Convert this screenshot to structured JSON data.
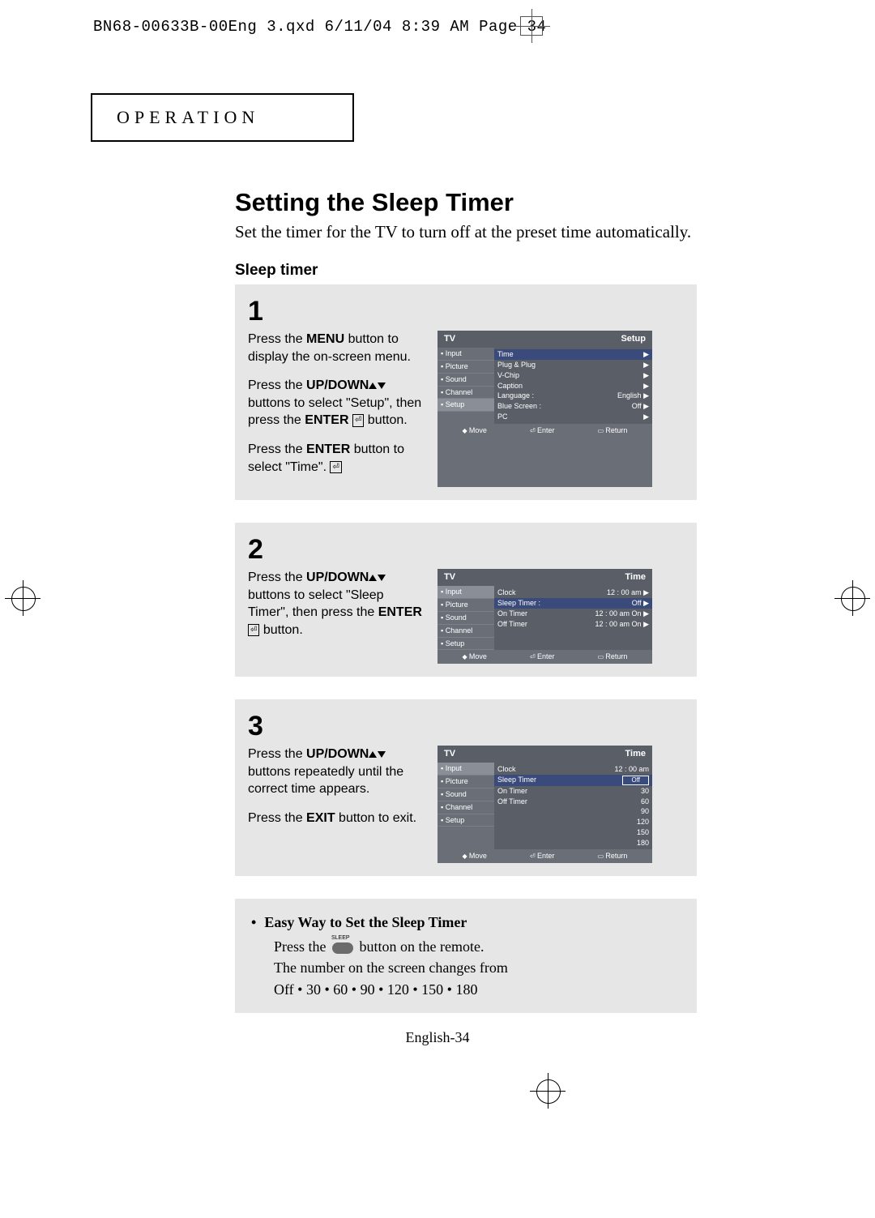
{
  "header": "BN68-00633B-00Eng 3.qxd  6/11/04 8:39 AM  Page 34",
  "section": "OPERATION",
  "title": "Setting the Sleep Timer",
  "intro": "Set the timer for the TV to turn off at the preset time automatically.",
  "subhead": "Sleep timer",
  "steps": [
    {
      "num": "1",
      "paras": [
        {
          "plain1": "Press the ",
          "b1": "MENU",
          "plain2": " button to display the on-screen menu."
        },
        {
          "plain1": "Press the ",
          "b1": "UP/DOWN",
          "icons": "ud",
          "plain2": " buttons to select \"Setup\", then press the ",
          "b2": "ENTER",
          "icon2": "enter",
          "plain3": " button."
        },
        {
          "plain1": "Press the ",
          "b1": "ENTER",
          "icon2": "enter",
          "plain2": " button to select \"Time\"."
        }
      ],
      "osd": {
        "title_left": "TV",
        "title_right": "Setup",
        "side": [
          "Input",
          "Picture",
          "Sound",
          "Channel",
          "Setup"
        ],
        "side_sel": 4,
        "rows": [
          {
            "l": "Time",
            "r": "▶",
            "hl": true
          },
          {
            "l": "Plug & Plug",
            "r": "▶"
          },
          {
            "l": "V-Chip",
            "r": "▶"
          },
          {
            "l": "Caption",
            "r": "▶"
          },
          {
            "l": "Language",
            "c": ":",
            "r": "English   ▶"
          },
          {
            "l": "Blue Screen",
            "c": ":",
            "r": "Off   ▶"
          },
          {
            "l": "PC",
            "r": "▶"
          }
        ],
        "foot": [
          "Move",
          "Enter",
          "Return"
        ]
      }
    },
    {
      "num": "2",
      "paras": [
        {
          "plain1": "Press the ",
          "b1": "UP/DOWN",
          "icons": "ud",
          "plain2": " buttons to select \"Sleep Timer\", then press the ",
          "b2": "ENTER",
          "icon2": "enter",
          "plain3": " button."
        }
      ],
      "osd": {
        "title_left": "TV",
        "title_right": "Time",
        "side": [
          "Input",
          "Picture",
          "Sound",
          "Channel",
          "Setup"
        ],
        "side_sel": 0,
        "rows": [
          {
            "l": "Clock",
            "r": "12 : 00  am   ▶"
          },
          {
            "l": "Sleep Timer",
            "c": ":",
            "r": "Off   ▶",
            "hl": true
          },
          {
            "l": "On Timer",
            "r": "12 : 00  am On ▶"
          },
          {
            "l": "Off Timer",
            "r": "12 : 00  am On ▶"
          }
        ],
        "foot": [
          "Move",
          "Enter",
          "Return"
        ]
      }
    },
    {
      "num": "3",
      "paras": [
        {
          "plain1": "Press the ",
          "b1": "UP/DOWN",
          "icons": "ud",
          "plain2": " buttons repeatedly until the correct time appears."
        },
        {
          "plain1": "Press the ",
          "b1": "EXIT",
          "plain2": " button to exit."
        }
      ],
      "osd": {
        "title_left": "TV",
        "title_right": "Time",
        "side": [
          "Input",
          "Picture",
          "Sound",
          "Channel",
          "Setup"
        ],
        "side_sel": 0,
        "rows": [
          {
            "l": "Clock",
            "r": "12 : 00  am"
          },
          {
            "l": "Sleep Timer",
            "r": "Off",
            "hl": true,
            "box": true
          },
          {
            "l": "On Timer",
            "r": "30"
          },
          {
            "l": "Off Timer",
            "r": "60"
          },
          {
            "l": "",
            "r": "90"
          },
          {
            "l": "",
            "r": "120"
          },
          {
            "l": "",
            "r": "150"
          },
          {
            "l": "",
            "r": "180"
          }
        ],
        "foot": [
          "Move",
          "Enter",
          "Return"
        ]
      }
    }
  ],
  "tip": {
    "heading": "Easy Way to Set the Sleep Timer",
    "l1a": "Press the ",
    "l1b": " button on the remote.",
    "l2": "The number on the screen changes from",
    "l3": "Off • 30 • 60 • 90 • 120 • 150 • 180"
  },
  "pagefoot": "English-34"
}
